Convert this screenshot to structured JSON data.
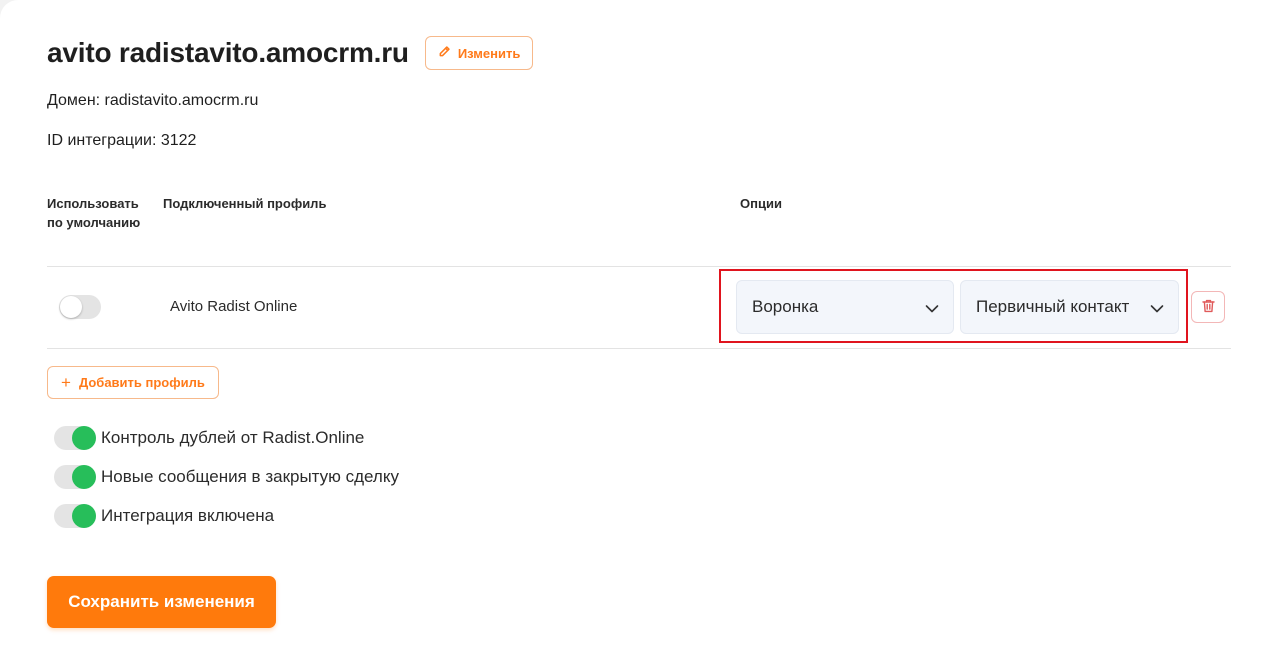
{
  "header": {
    "title": "avito radistavito.amocrm.ru",
    "edit_label": "Изменить"
  },
  "meta": {
    "domain": "Домен: radistavito.amocrm.ru",
    "integration_id": "ID интеграции: 3122"
  },
  "table": {
    "columns": {
      "default": "Использовать по умолчанию",
      "profile": "Подключенный профиль",
      "options": "Опции"
    },
    "rows": [
      {
        "default_enabled": false,
        "profile": "Avito Radist Online",
        "funnel": "Воронка",
        "stage": "Первичный контакт"
      }
    ]
  },
  "add_profile_label": "Добавить профиль",
  "options": [
    {
      "label": "Контроль дублей от Radist.Online",
      "enabled": true
    },
    {
      "label": "Новые сообщения в закрытую сделку",
      "enabled": true
    },
    {
      "label": "Интеграция включена",
      "enabled": true
    }
  ],
  "save_label": "Сохранить изменения",
  "colors": {
    "accent": "#ff7a0c",
    "toggle_on": "#27be5a",
    "highlight": "#e0141e",
    "danger": "#e05a5a"
  },
  "icons": {
    "edit": "pencil-icon",
    "select": "chevron-down-icon",
    "delete": "trash-icon",
    "add": "plus-icon"
  }
}
